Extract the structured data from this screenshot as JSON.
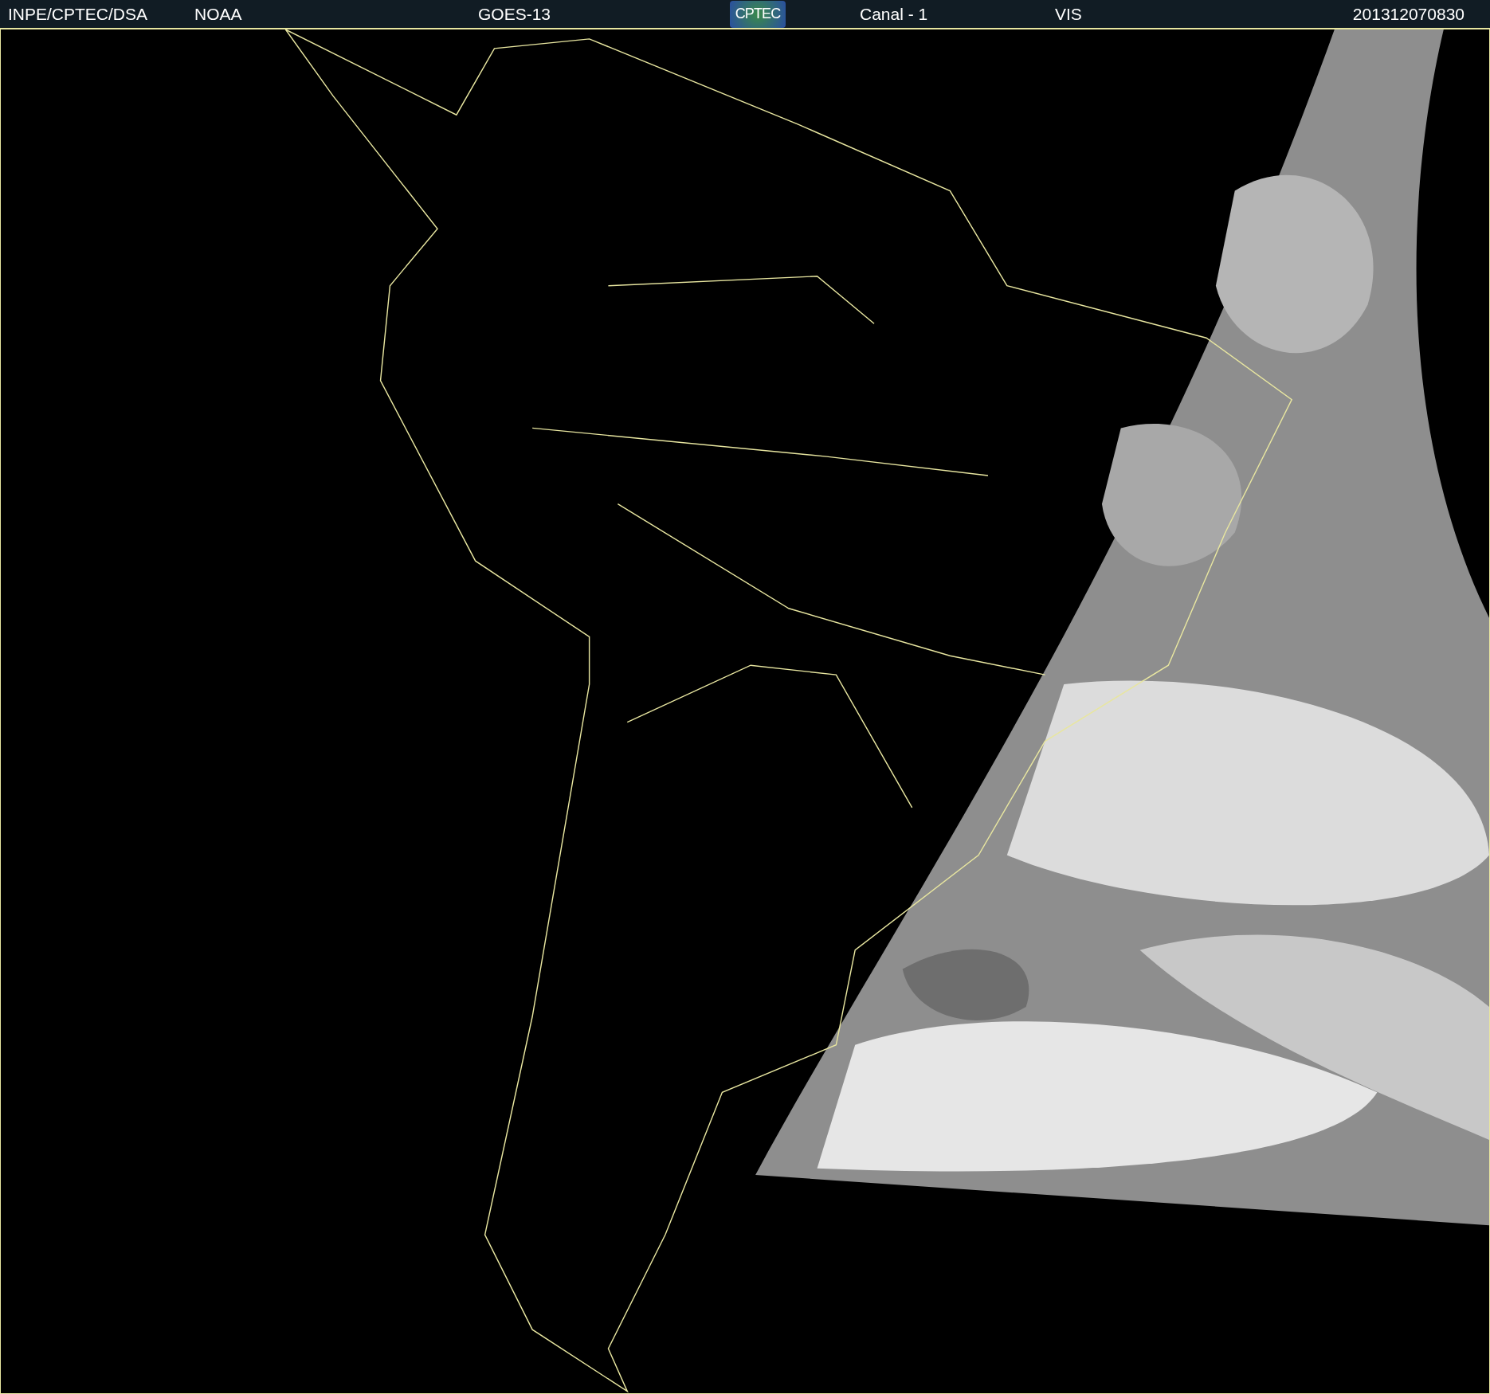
{
  "header": {
    "source": "INPE/CPTEC/DSA",
    "agency": "NOAA",
    "satellite": "GOES-13",
    "logo": "CPTEC",
    "channel": "Canal - 1",
    "band": "VIS",
    "timestamp": "201312070830"
  }
}
